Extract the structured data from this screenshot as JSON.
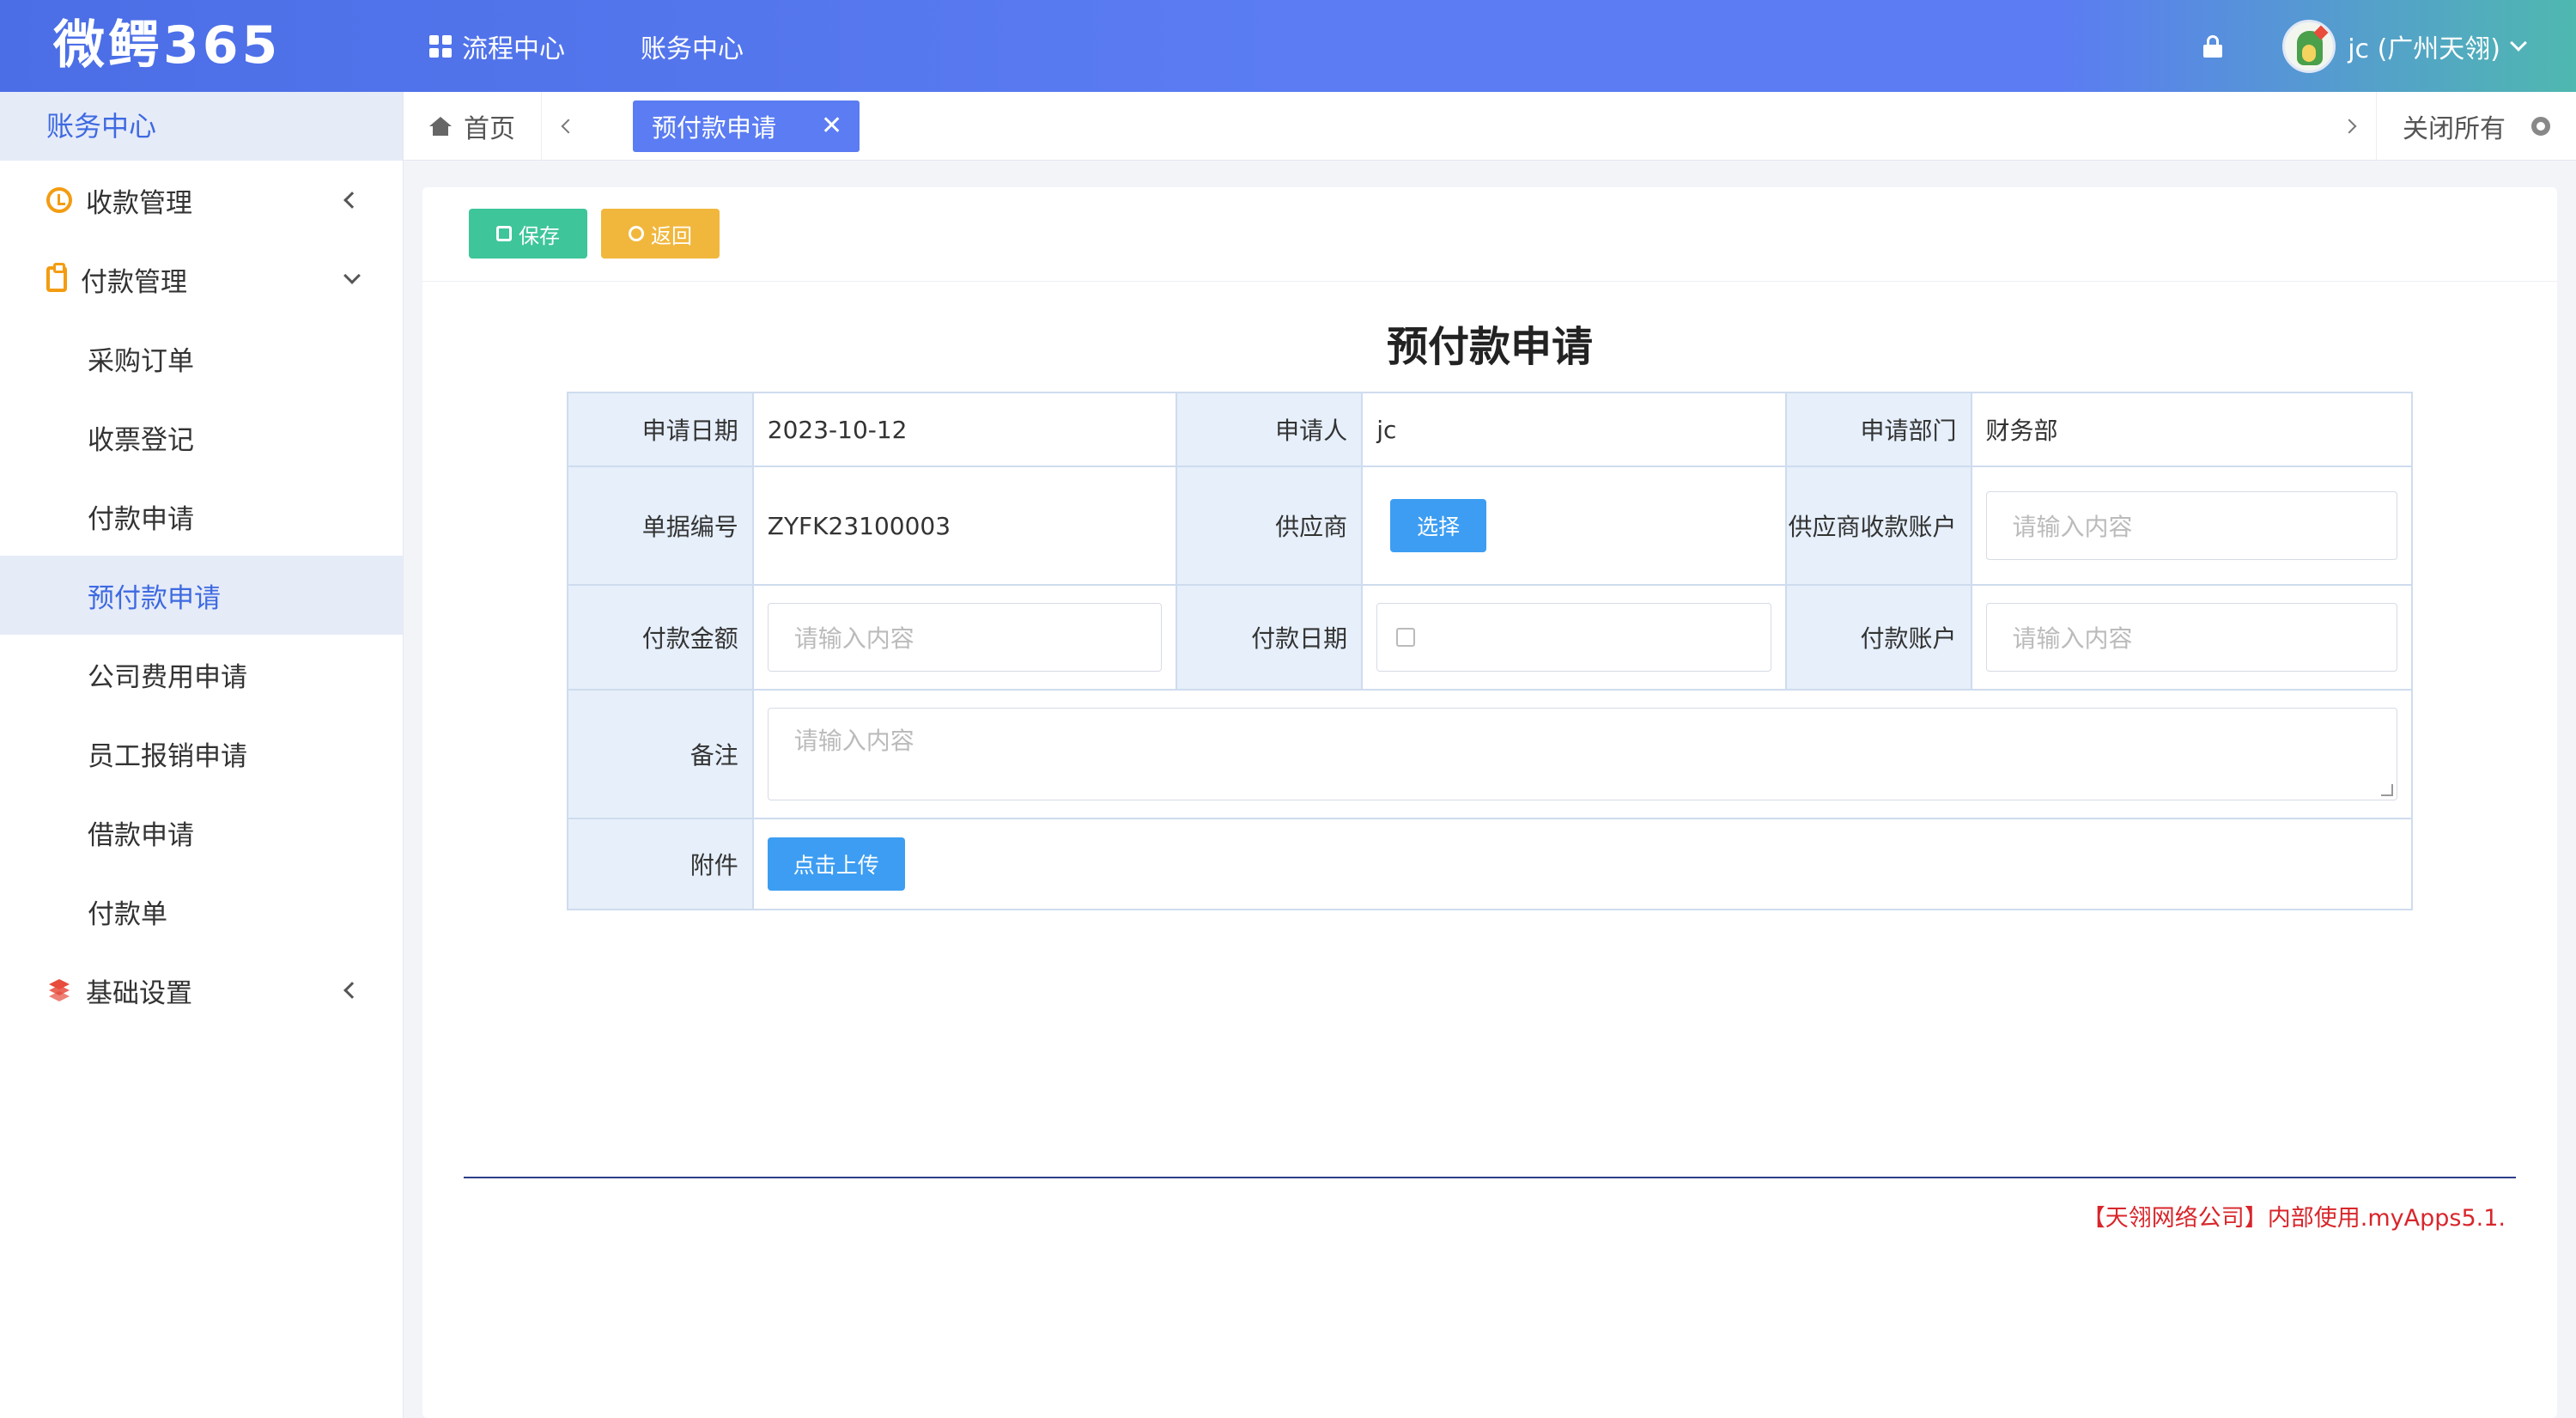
{
  "header": {
    "logo": "微鳄365",
    "nav": [
      {
        "label": "流程中心"
      },
      {
        "label": "账务中心"
      }
    ],
    "username": "jc (广州天翎)"
  },
  "sidebar": {
    "title": "账务中心",
    "groups": [
      {
        "label": "收款管理"
      },
      {
        "label": "付款管理"
      },
      {
        "label": "基础设置"
      }
    ],
    "sub_items": [
      {
        "label": "采购订单"
      },
      {
        "label": "收票登记"
      },
      {
        "label": "付款申请"
      },
      {
        "label": "预付款申请"
      },
      {
        "label": "公司费用申请"
      },
      {
        "label": "员工报销申请"
      },
      {
        "label": "借款申请"
      },
      {
        "label": "付款单"
      }
    ]
  },
  "tabs": {
    "home": "首页",
    "active": "预付款申请",
    "close_symbol": "✕",
    "close_all": "关闭所有"
  },
  "toolbar": {
    "save": "保存",
    "back": "返回"
  },
  "form": {
    "title": "预付款申请",
    "apply_date_label": "申请日期",
    "apply_date": "2023-10-12",
    "applicant_label": "申请人",
    "applicant": "jc",
    "dept_label": "申请部门",
    "dept": "财务部",
    "doc_no_label": "单据编号",
    "doc_no": "ZYFK23100003",
    "supplier_label": "供应商",
    "supplier_button": "选择",
    "supplier_account_label": "供应商收款账户",
    "amount_label": "付款金额",
    "pay_date_label": "付款日期",
    "pay_account_label": "付款账户",
    "remark_label": "备注",
    "attachment_label": "附件",
    "upload_button": "点击上传",
    "placeholder": "请输入内容"
  },
  "footer_note": "【天翎网络公司】内部使用.myApps5.1.",
  "colors": {
    "primary": "#5b7cf2",
    "save": "#3ec59a",
    "back": "#f1b73d",
    "button_blue": "#3d9df2",
    "footer_red": "#d8262b"
  }
}
